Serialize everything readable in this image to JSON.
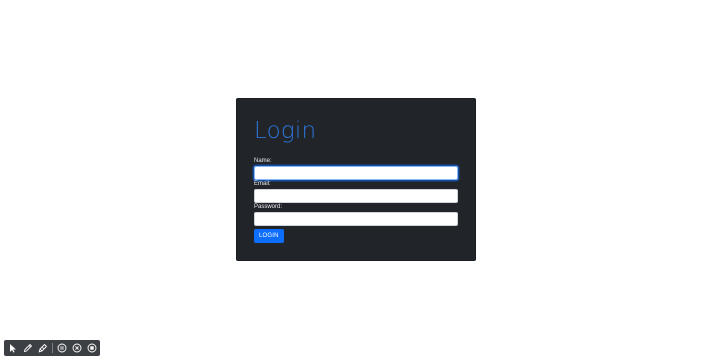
{
  "login_form": {
    "title": "Login",
    "name_label": "Name:",
    "name_value": "",
    "email_label": "Email:",
    "email_value": "",
    "password_label": "Password:",
    "password_value": "",
    "submit_label": "LOGIN"
  },
  "toolbar": {
    "tools": [
      "pointer-icon",
      "pen-icon",
      "highlighter-icon",
      "pause-icon",
      "close-circle-icon",
      "stop-icon"
    ]
  },
  "colors": {
    "card_bg": "#212529",
    "title": "#2c74d8",
    "button": "#0d6efd",
    "toolbar_bg": "#3c3f43"
  }
}
